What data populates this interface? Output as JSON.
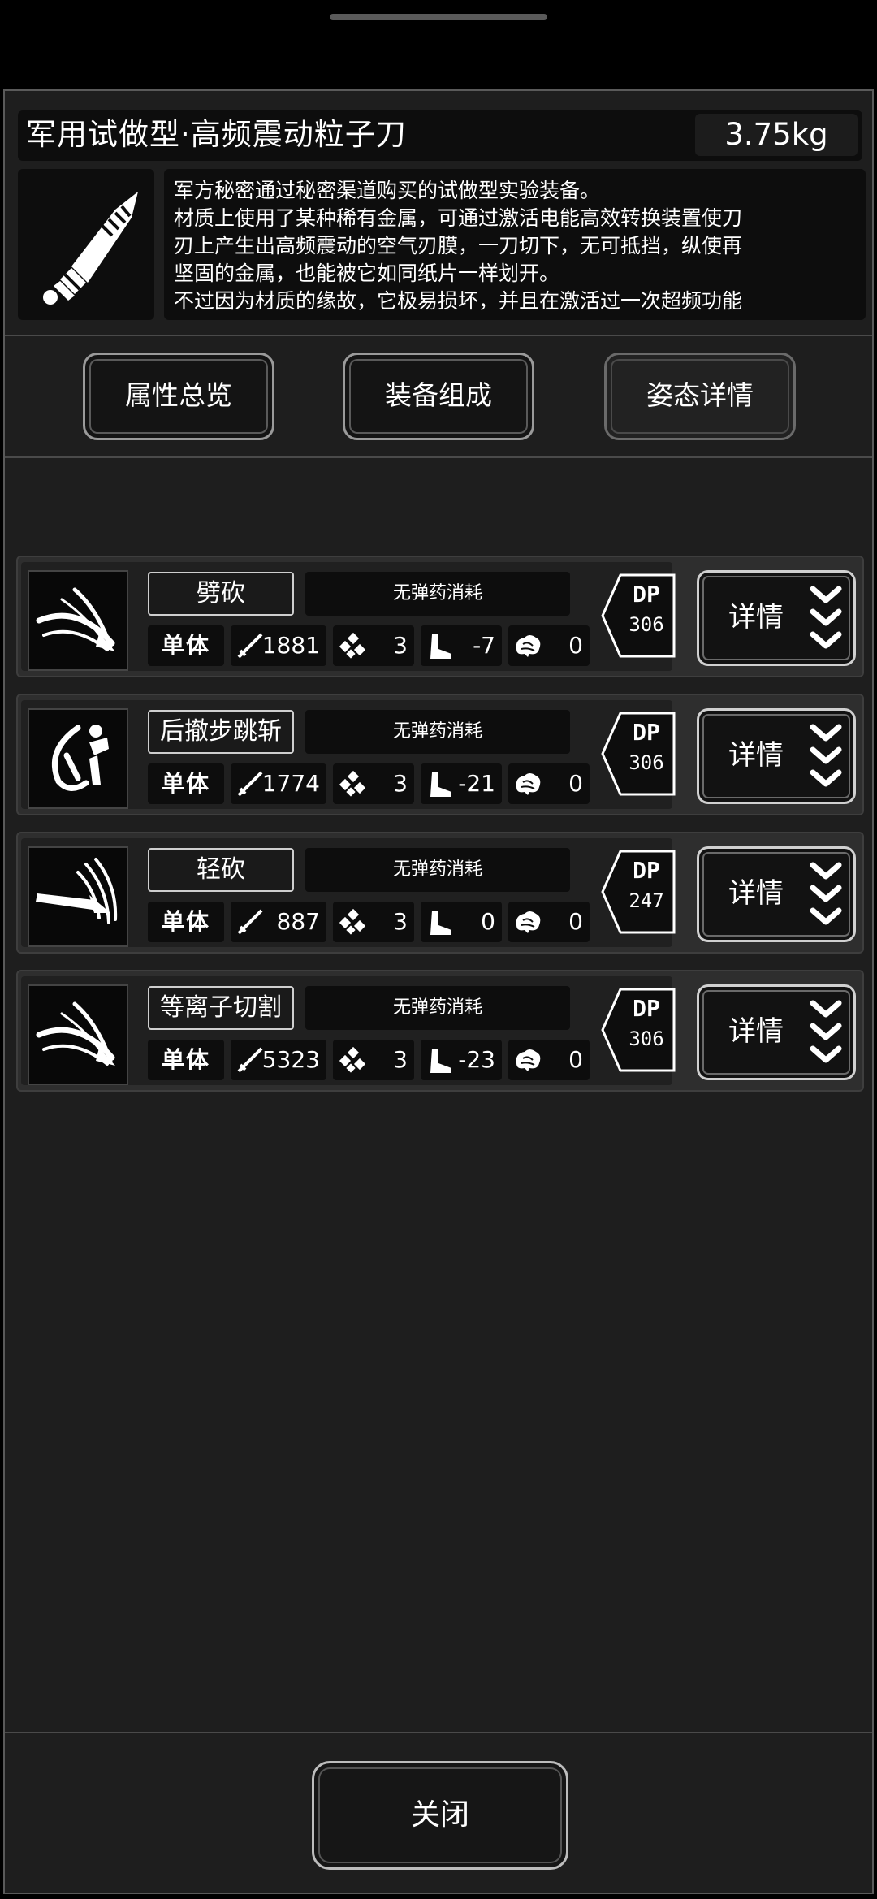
{
  "equipment": {
    "name": "军用试做型·高频震动粒子刀",
    "weight": "3.75kg",
    "icon": "knife-icon",
    "description": [
      "军方秘密通过秘密渠道购买的试做型实验装备。",
      "材质上使用了某种稀有金属，可通过激活电能高效转换装置使刀",
      "刃上产生出高频震动的空气刃膜，一刀切下，无可抵挡，纵使再",
      "坚固的金属，也能被它如同纸片一样划开。",
      "不过因为材质的缘故，它极易损坏，并且在激活过一次超频功能"
    ]
  },
  "tabs": [
    {
      "label": "属性总览"
    },
    {
      "label": "装备组成"
    },
    {
      "label": "姿态详情"
    }
  ],
  "stances": [
    {
      "name": "劈砍",
      "ammo": "无弹药消耗",
      "target": "单体",
      "attack": "1881",
      "hit": "3",
      "move": "-7",
      "ammo_cost": "0",
      "dp_label": "DP",
      "dp": "306",
      "detail": "详情",
      "icon": "slash-arc-icon"
    },
    {
      "name": "后撤步跳斩",
      "ammo": "无弹药消耗",
      "target": "单体",
      "attack": "1774",
      "hit": "3",
      "move": "-21",
      "ammo_cost": "0",
      "dp_label": "DP",
      "dp": "306",
      "detail": "详情",
      "icon": "backstep-slash-icon"
    },
    {
      "name": "轻砍",
      "ammo": "无弹药消耗",
      "target": "单体",
      "attack": "887",
      "hit": "3",
      "move": "0",
      "ammo_cost": "0",
      "dp_label": "DP",
      "dp": "247",
      "detail": "详情",
      "icon": "light-slash-icon"
    },
    {
      "name": "等离子切割",
      "ammo": "无弹药消耗",
      "target": "单体",
      "attack": "5323",
      "hit": "3",
      "move": "-23",
      "ammo_cost": "0",
      "dp_label": "DP",
      "dp": "306",
      "detail": "详情",
      "icon": "slash-arc-icon"
    }
  ],
  "close_label": "关闭"
}
